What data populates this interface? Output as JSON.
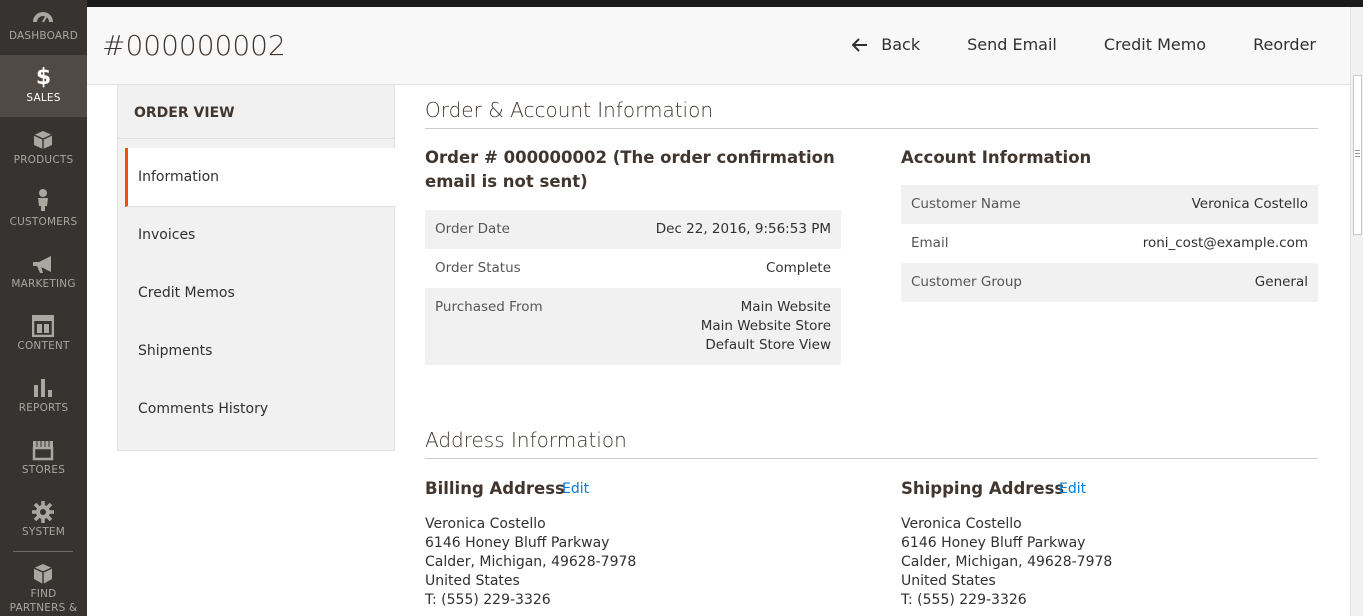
{
  "nav": {
    "items": [
      {
        "label": "DASHBOARD"
      },
      {
        "label": "SALES"
      },
      {
        "label": "PRODUCTS"
      },
      {
        "label": "CUSTOMERS"
      },
      {
        "label": "MARKETING"
      },
      {
        "label": "CONTENT"
      },
      {
        "label": "REPORTS"
      },
      {
        "label": "STORES"
      },
      {
        "label": "SYSTEM"
      },
      {
        "label_line1": "FIND",
        "label_line2": "PARTNERS &"
      }
    ]
  },
  "header": {
    "title": "#000000002",
    "back_label": "Back",
    "send_email_label": "Send Email",
    "credit_memo_label": "Credit Memo",
    "reorder_label": "Reorder"
  },
  "order_view": {
    "title": "ORDER VIEW",
    "tabs": [
      {
        "label": "Information"
      },
      {
        "label": "Invoices"
      },
      {
        "label": "Credit Memos"
      },
      {
        "label": "Shipments"
      },
      {
        "label": "Comments History"
      }
    ]
  },
  "order_account": {
    "section_title": "Order & Account Information",
    "order_heading_line1": "Order # 000000002 (The order confirmation",
    "order_heading_line2": "email is not sent)",
    "order_rows": {
      "date_label": "Order Date",
      "date_value": "Dec 22, 2016, 9:56:53 PM",
      "status_label": "Order Status",
      "status_value": "Complete",
      "purchased_label": "Purchased From",
      "purchased_line1": "Main Website",
      "purchased_line2": "Main Website Store",
      "purchased_line3": "Default Store View"
    },
    "account_heading": "Account Information",
    "account_rows": {
      "name_label": "Customer Name",
      "name_value": "Veronica Costello",
      "email_label": "Email",
      "email_value": "roni_cost@example.com",
      "group_label": "Customer Group",
      "group_value": "General"
    }
  },
  "address": {
    "section_title": "Address Information",
    "edit_label": "Edit",
    "billing": {
      "heading": "Billing Address",
      "lines": [
        "Veronica Costello",
        "6146 Honey Bluff Parkway",
        "Calder, Michigan, 49628-7978",
        "United States",
        "T: (555) 229-3326"
      ]
    },
    "shipping": {
      "heading": "Shipping Address",
      "lines": [
        "Veronica Costello",
        "6146 Honey Bluff Parkway",
        "Calder, Michigan, 49628-7978",
        "United States",
        "T: (555) 229-3326"
      ]
    }
  },
  "colors": {
    "nav_bg": "#373330",
    "nav_active": "#514943",
    "accent": "#eb5202",
    "link": "#007bdb"
  }
}
